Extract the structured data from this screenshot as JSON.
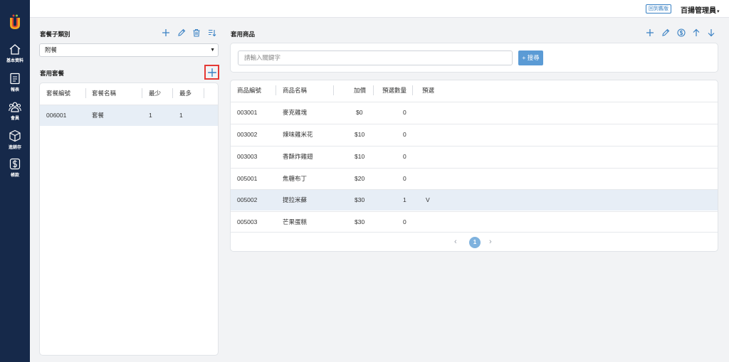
{
  "sidebar": {
    "items": [
      {
        "icon": "home-icon",
        "label": "基本資料"
      },
      {
        "icon": "report-icon",
        "label": "報表"
      },
      {
        "icon": "members-icon",
        "label": "會員"
      },
      {
        "icon": "inventory-icon",
        "label": "進銷存"
      },
      {
        "icon": "dollar-icon",
        "label": "帳款"
      }
    ]
  },
  "topbar": {
    "back_label": "回到舊版",
    "user_name": "百揚管理員",
    "user_caret": "▾"
  },
  "left": {
    "subcategory_title": "套餐子類別",
    "subcategory_selected": "附餐",
    "combo_title": "套用套餐",
    "combo_table": {
      "headers": [
        "套餐編號",
        "套餐名稱",
        "最少",
        "最多"
      ],
      "rows": [
        [
          "006001",
          "套餐",
          "1",
          "1"
        ]
      ]
    }
  },
  "right": {
    "products_title": "套用商品",
    "search": {
      "placeholder": "請輸入關鍵字",
      "button_label": "+ 搜尋"
    },
    "product_table": {
      "headers": [
        "商品編號",
        "商品名稱",
        "加價",
        "預選數量",
        "預選"
      ],
      "rows": [
        [
          "003001",
          "麥克雞塊",
          "$0",
          "0",
          ""
        ],
        [
          "003002",
          "辣味雞米花",
          "$10",
          "0",
          ""
        ],
        [
          "003003",
          "香酥炸雞翅",
          "$10",
          "0",
          ""
        ],
        [
          "005001",
          "焦糖布丁",
          "$20",
          "0",
          ""
        ],
        [
          "005002",
          "提拉米蘇",
          "$30",
          "1",
          "V"
        ],
        [
          "005003",
          "芒果蛋糕",
          "$30",
          "0",
          ""
        ]
      ]
    },
    "pagination": {
      "prev": "‹",
      "current": "1",
      "next": "›"
    }
  },
  "colors": {
    "sidebar_bg": "#16294a",
    "accent": "#3b82c4",
    "highlight": "#e53935",
    "selected_row": "#e7eef6"
  }
}
